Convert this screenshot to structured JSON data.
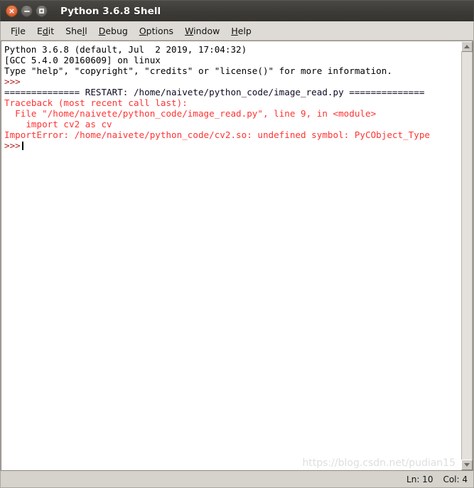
{
  "window": {
    "title": "Python 3.6.8 Shell",
    "controls": [
      {
        "name": "close",
        "glyph": "×",
        "tooltip": "Close"
      },
      {
        "name": "minimize",
        "glyph": "–",
        "tooltip": "Minimize"
      },
      {
        "name": "maximize",
        "glyph": "□",
        "tooltip": "Maximize"
      }
    ]
  },
  "menubar": {
    "items": [
      {
        "label": "File",
        "pre": "F",
        "mnemonic": "i",
        "post": "le"
      },
      {
        "label": "Edit",
        "pre": "E",
        "mnemonic": "d",
        "post": "it"
      },
      {
        "label": "Shell",
        "pre": "She",
        "mnemonic": "l",
        "post": "l"
      },
      {
        "label": "Debug",
        "pre": "",
        "mnemonic": "D",
        "post": "ebug"
      },
      {
        "label": "Options",
        "pre": "",
        "mnemonic": "O",
        "post": "ptions"
      },
      {
        "label": "Window",
        "pre": "",
        "mnemonic": "W",
        "post": "indow"
      },
      {
        "label": "Help",
        "pre": "",
        "mnemonic": "H",
        "post": "elp"
      }
    ]
  },
  "shell": {
    "lines": [
      {
        "text": "Python 3.6.8 (default, Jul  2 2019, 17:04:32)",
        "color": "black"
      },
      {
        "text": "[GCC 5.4.0 20160609] on linux",
        "color": "black"
      },
      {
        "text": "Type \"help\", \"copyright\", \"credits\" or \"license()\" for more information.",
        "color": "black"
      },
      {
        "text": ">>>",
        "color": "prompt"
      },
      {
        "text": "============== RESTART: /home/naivete/python_code/image_read.py ==============",
        "color": "restart"
      },
      {
        "text": "Traceback (most recent call last):",
        "color": "red"
      },
      {
        "text": "  File \"/home/naivete/python_code/image_read.py\", line 9, in <module>",
        "color": "red"
      },
      {
        "text": "    import cv2 as cv",
        "color": "red"
      },
      {
        "text": "ImportError: /home/naivete/python_code/cv2.so: undefined symbol: PyCObject_Type",
        "color": "red"
      },
      {
        "text": ">>>",
        "color": "prompt",
        "caret": true
      }
    ],
    "watermark": "https://blog.csdn.net/pudian15"
  },
  "scrollbar": {
    "up_arrow": "scroll-up-arrow",
    "down_arrow": "scroll-down-arrow"
  },
  "statusbar": {
    "line": "Ln: 10",
    "column": "Col: 4"
  },
  "colors": {
    "titlebar": "#3d3b37",
    "close_button": "#e2703d",
    "chrome": "#d6d3cd",
    "menubar": "#dedbd6",
    "text_black": "#000000",
    "text_error": "#ff3333",
    "text_prompt": "#b32020",
    "text_restart": "#0b0b23"
  }
}
